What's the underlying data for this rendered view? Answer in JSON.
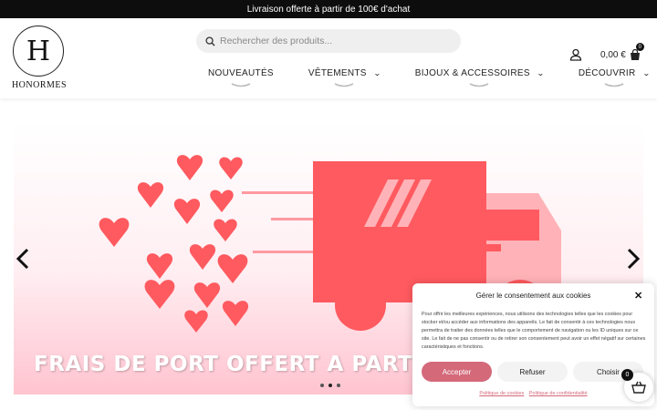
{
  "topbar": {
    "text": "Livraison offerte à partir de 100€ d'achat"
  },
  "logo": {
    "mark": "H",
    "name": "HONORMES"
  },
  "search": {
    "placeholder": "Rechercher des produits..."
  },
  "nav": {
    "items": [
      {
        "label": "NOUVEAUTÉS"
      },
      {
        "label": "VÊTEMENTS"
      },
      {
        "label": "BIJOUX & ACCESSOIRES"
      },
      {
        "label": "DÉCOUVRIR"
      }
    ]
  },
  "cart": {
    "amount": "0,00 €",
    "count": "0"
  },
  "slider": {
    "text": "FRAIS DE PORT OFFERT A PARTIR",
    "dots": 3,
    "active_dot": 2,
    "colors": {
      "truck": "#ff5a5f",
      "truck_light": "#ffb3b8",
      "heart": "#ff5a5f"
    }
  },
  "consent": {
    "title": "Gérer le consentement aux cookies",
    "body": "Pour offrir les meilleures expériences, nous utilisons des technologies telles que les cookies pour stocker et/ou accéder aux informations des appareils. Le fait de consentir à ces technologies nous permettra de traiter des données telles que le comportement de navigation ou les ID uniques sur ce site. Le fait de ne pas consentir ou de retirer son consentement peut avoir un effet négatif sur certaines caractéristiques et fonctions.",
    "accept": "Accepter",
    "refuse": "Refuser",
    "choose": "Choisir",
    "link_cookies": "Politique de cookies",
    "link_privacy": "Politique de confidentialité",
    "accent": "#d4697a"
  },
  "floating_cart": {
    "count": "0"
  }
}
